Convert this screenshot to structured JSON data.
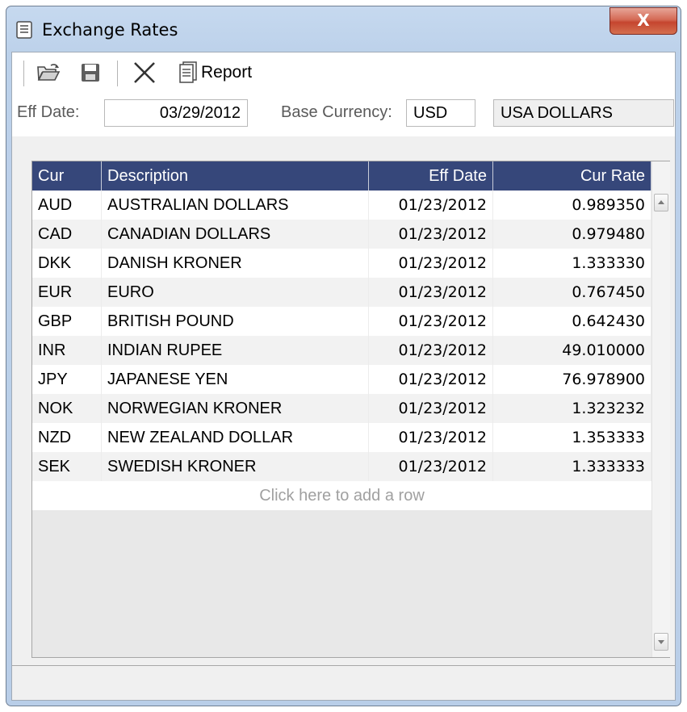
{
  "window": {
    "title": "Exchange Rates",
    "close_glyph": "X"
  },
  "toolbar": {
    "open_icon": "folder-open-icon",
    "save_icon": "save-disk-icon",
    "delete_icon": "delete-x-icon",
    "report_icon": "report-icon",
    "report_label": "Report"
  },
  "form": {
    "eff_date_label": "Eff Date:",
    "eff_date_value": "03/29/2012",
    "base_currency_label": "Base Currency:",
    "base_currency_code": "USD",
    "base_currency_name": "USA DOLLARS"
  },
  "grid": {
    "columns": [
      "Cur",
      "Description",
      "Eff Date",
      "Cur Rate"
    ],
    "rows": [
      [
        "AUD",
        "AUSTRALIAN DOLLARS",
        "01/23/2012",
        "0.989350"
      ],
      [
        "CAD",
        "CANADIAN DOLLARS",
        "01/23/2012",
        "0.979480"
      ],
      [
        "DKK",
        "DANISH KRONER",
        "01/23/2012",
        "1.333330"
      ],
      [
        "EUR",
        "EURO",
        "01/23/2012",
        "0.767450"
      ],
      [
        "GBP",
        "BRITISH POUND",
        "01/23/2012",
        "0.642430"
      ],
      [
        "INR",
        "INDIAN RUPEE",
        "01/23/2012",
        "49.010000"
      ],
      [
        "JPY",
        "JAPANESE YEN",
        "01/23/2012",
        "76.978900"
      ],
      [
        "NOK",
        "NORWEGIAN KRONER",
        "01/23/2012",
        "1.323232"
      ],
      [
        "NZD",
        "NEW ZEALAND DOLLAR",
        "01/23/2012",
        "1.353333"
      ],
      [
        "SEK",
        "SWEDISH KRONER",
        "01/23/2012",
        "1.333333"
      ]
    ],
    "add_row_text": "Click here to add a row"
  },
  "colors": {
    "header_bg": "#36477a",
    "title_bar": "#bcd1ea",
    "close_button": "#c5452f"
  }
}
